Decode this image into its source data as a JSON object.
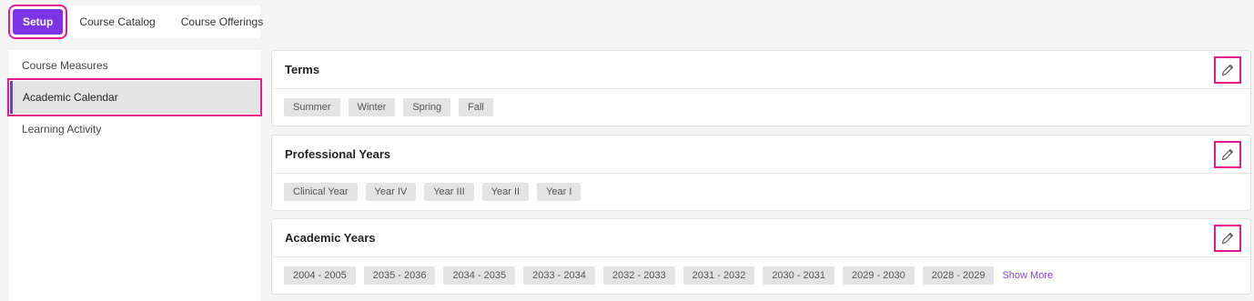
{
  "tabs": [
    {
      "label": "Setup",
      "active": true
    },
    {
      "label": "Course Catalog",
      "active": false
    },
    {
      "label": "Course Offerings",
      "active": false
    }
  ],
  "sidebar": {
    "items": [
      {
        "label": "Course Measures",
        "active": false
      },
      {
        "label": "Academic Calendar",
        "active": true
      },
      {
        "label": "Learning Activity",
        "active": false
      }
    ]
  },
  "panels": {
    "terms": {
      "title": "Terms",
      "edit_icon": "pencil-icon",
      "chips": [
        "Summer",
        "Winter",
        "Spring",
        "Fall"
      ]
    },
    "professional_years": {
      "title": "Professional Years",
      "edit_icon": "pencil-icon",
      "chips": [
        "Clinical Year",
        "Year IV",
        "Year III",
        "Year II",
        "Year I"
      ]
    },
    "academic_years": {
      "title": "Academic Years",
      "edit_icon": "pencil-icon",
      "chips": [
        "2004 - 2005",
        "2035 - 2036",
        "2034 - 2035",
        "2033 - 2034",
        "2032 - 2033",
        "2031 - 2032",
        "2030 - 2031",
        "2029 - 2030",
        "2028 - 2029"
      ],
      "show_more": "Show More"
    }
  },
  "colors": {
    "accent": "#7b35e6",
    "highlight": "#e8198a",
    "chip_bg": "#e3e3e3",
    "link": "#8a3fe0"
  }
}
